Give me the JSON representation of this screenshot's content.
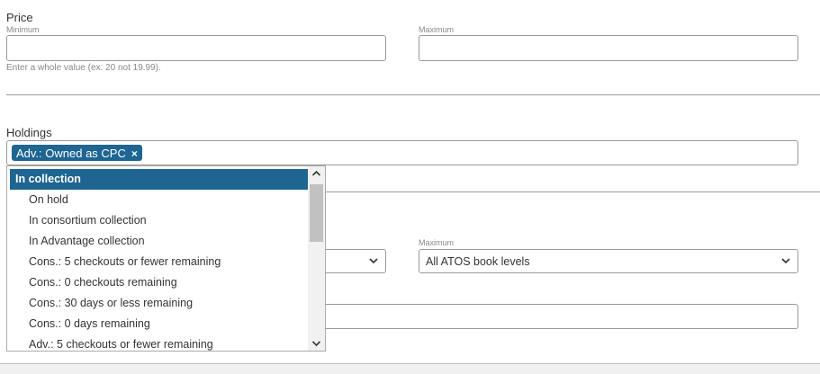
{
  "price": {
    "title": "Price",
    "min_label": "Minimum",
    "max_label": "Maximum",
    "min_value": "",
    "max_value": "",
    "hint": "Enter a whole value (ex: 20 not 19.99)."
  },
  "holdings": {
    "title": "Holdings",
    "selected_token": "Adv.: Owned as CPC",
    "token_remove_glyph": "×"
  },
  "dropdown": {
    "items": [
      {
        "label": "In collection",
        "type": "group",
        "selected": true
      },
      {
        "label": "On hold",
        "type": "option"
      },
      {
        "label": "In consortium collection",
        "type": "option"
      },
      {
        "label": "In Advantage collection",
        "type": "option"
      },
      {
        "label": "Cons.: 5 checkouts or fewer remaining",
        "type": "option"
      },
      {
        "label": "Cons.: 0 checkouts remaining",
        "type": "option"
      },
      {
        "label": "Cons.: 30 days or less remaining",
        "type": "option"
      },
      {
        "label": "Cons.: 0 days remaining",
        "type": "option"
      },
      {
        "label": "Adv.: 5 checkouts or fewer remaining",
        "type": "option"
      }
    ],
    "scrollbar": {
      "up_icon": "chevron-up-icon",
      "down_icon": "chevron-down-icon"
    }
  },
  "atos": {
    "max_label": "Maximum",
    "max_selected": "All ATOS book levels",
    "min_selected": ""
  },
  "colors": {
    "accent": "#1e6592",
    "border": "#999999",
    "divider": "#999999"
  }
}
